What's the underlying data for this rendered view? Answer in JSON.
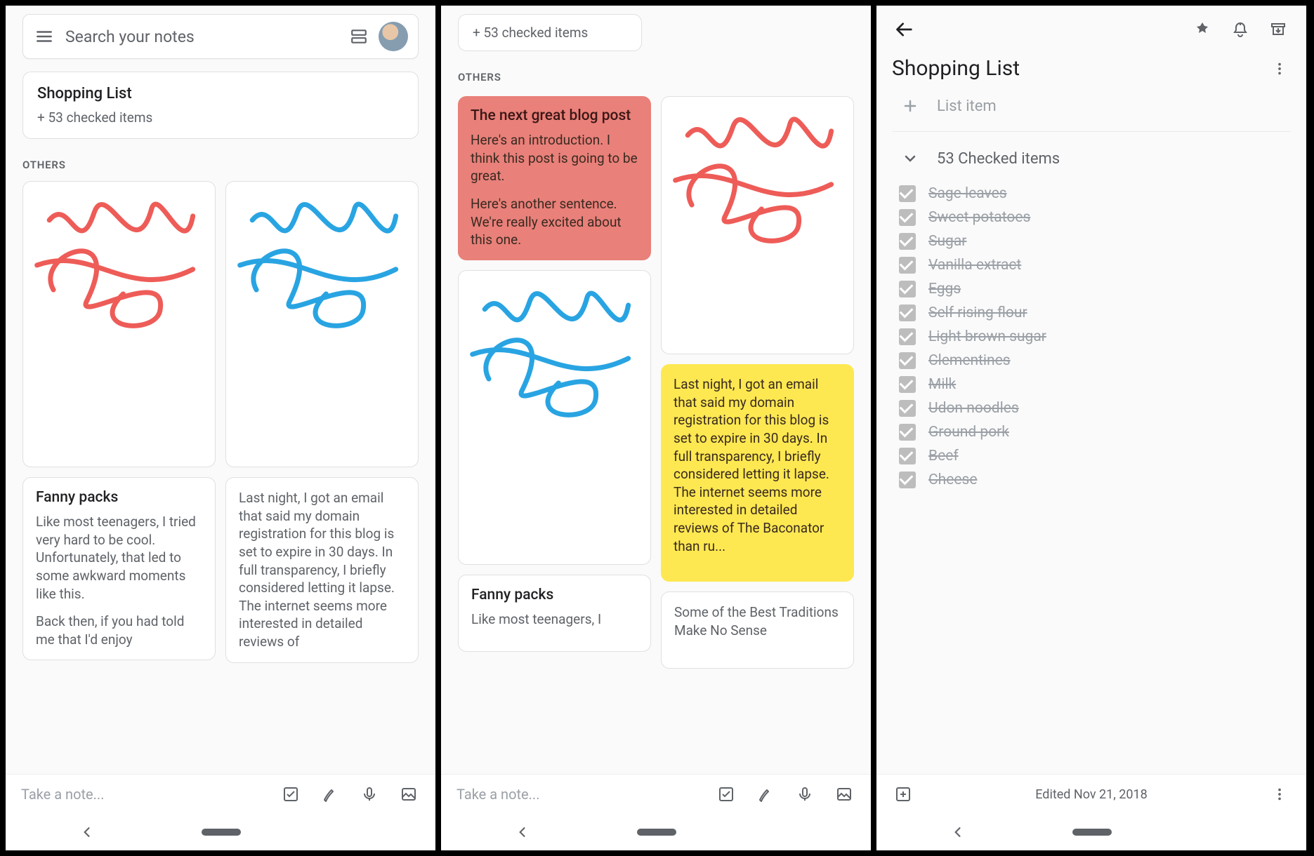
{
  "search": {
    "placeholder": "Search your notes"
  },
  "pinned": {
    "title": "Shopping List",
    "subline": "+ 53 checked items"
  },
  "sections": {
    "others": "OTHERS"
  },
  "notes": {
    "blog": {
      "title": "The next great blog post",
      "p1": "Here's an introduction. I think this post is going to be great.",
      "p2": "Here's another sentence. We're really excited about this one."
    },
    "fanny": {
      "title": "Fanny packs",
      "p1": "Like most teenagers, I tried very hard to be cool. Unfortunately, that led to some awkward moments like this.",
      "p2": "Back then, if you had told me that I'd enjoy",
      "p1_short": "Like most teenagers, I"
    },
    "domain": {
      "body": "Last night, I got an email that said my domain registration for this blog is set to expire in 30 days. In full transparency, I briefly considered letting it lapse. The internet seems more interested in detailed reviews of",
      "body_trunc": "Last night, I got an email that said my domain registration for this blog is set to expire in 30 days. In full transparency, I briefly considered letting it lapse. The internet seems more interested in detailed reviews of The Baconator than ru..."
    },
    "traditions": {
      "body": "Some of the Best Traditions Make No Sense"
    }
  },
  "bottom": {
    "take_note": "Take a note..."
  },
  "detail": {
    "title": "Shopping List",
    "add_label": "List item",
    "checked_label": "53 Checked items",
    "items": [
      "Sage leaves",
      "Sweet potatoes",
      "Sugar",
      "Vanilla extract",
      "Eggs",
      "Self rising flour",
      "Light brown sugar",
      "Clementines",
      "Milk",
      "Udon noodles",
      "Ground pork",
      "Beef",
      "Cheese"
    ],
    "edited": "Edited Nov 21, 2018"
  },
  "colors": {
    "red_card": "#e9807a",
    "yellow_card": "#fde851",
    "stroke_red": "#ee5c58",
    "stroke_blue": "#29a4e2"
  }
}
